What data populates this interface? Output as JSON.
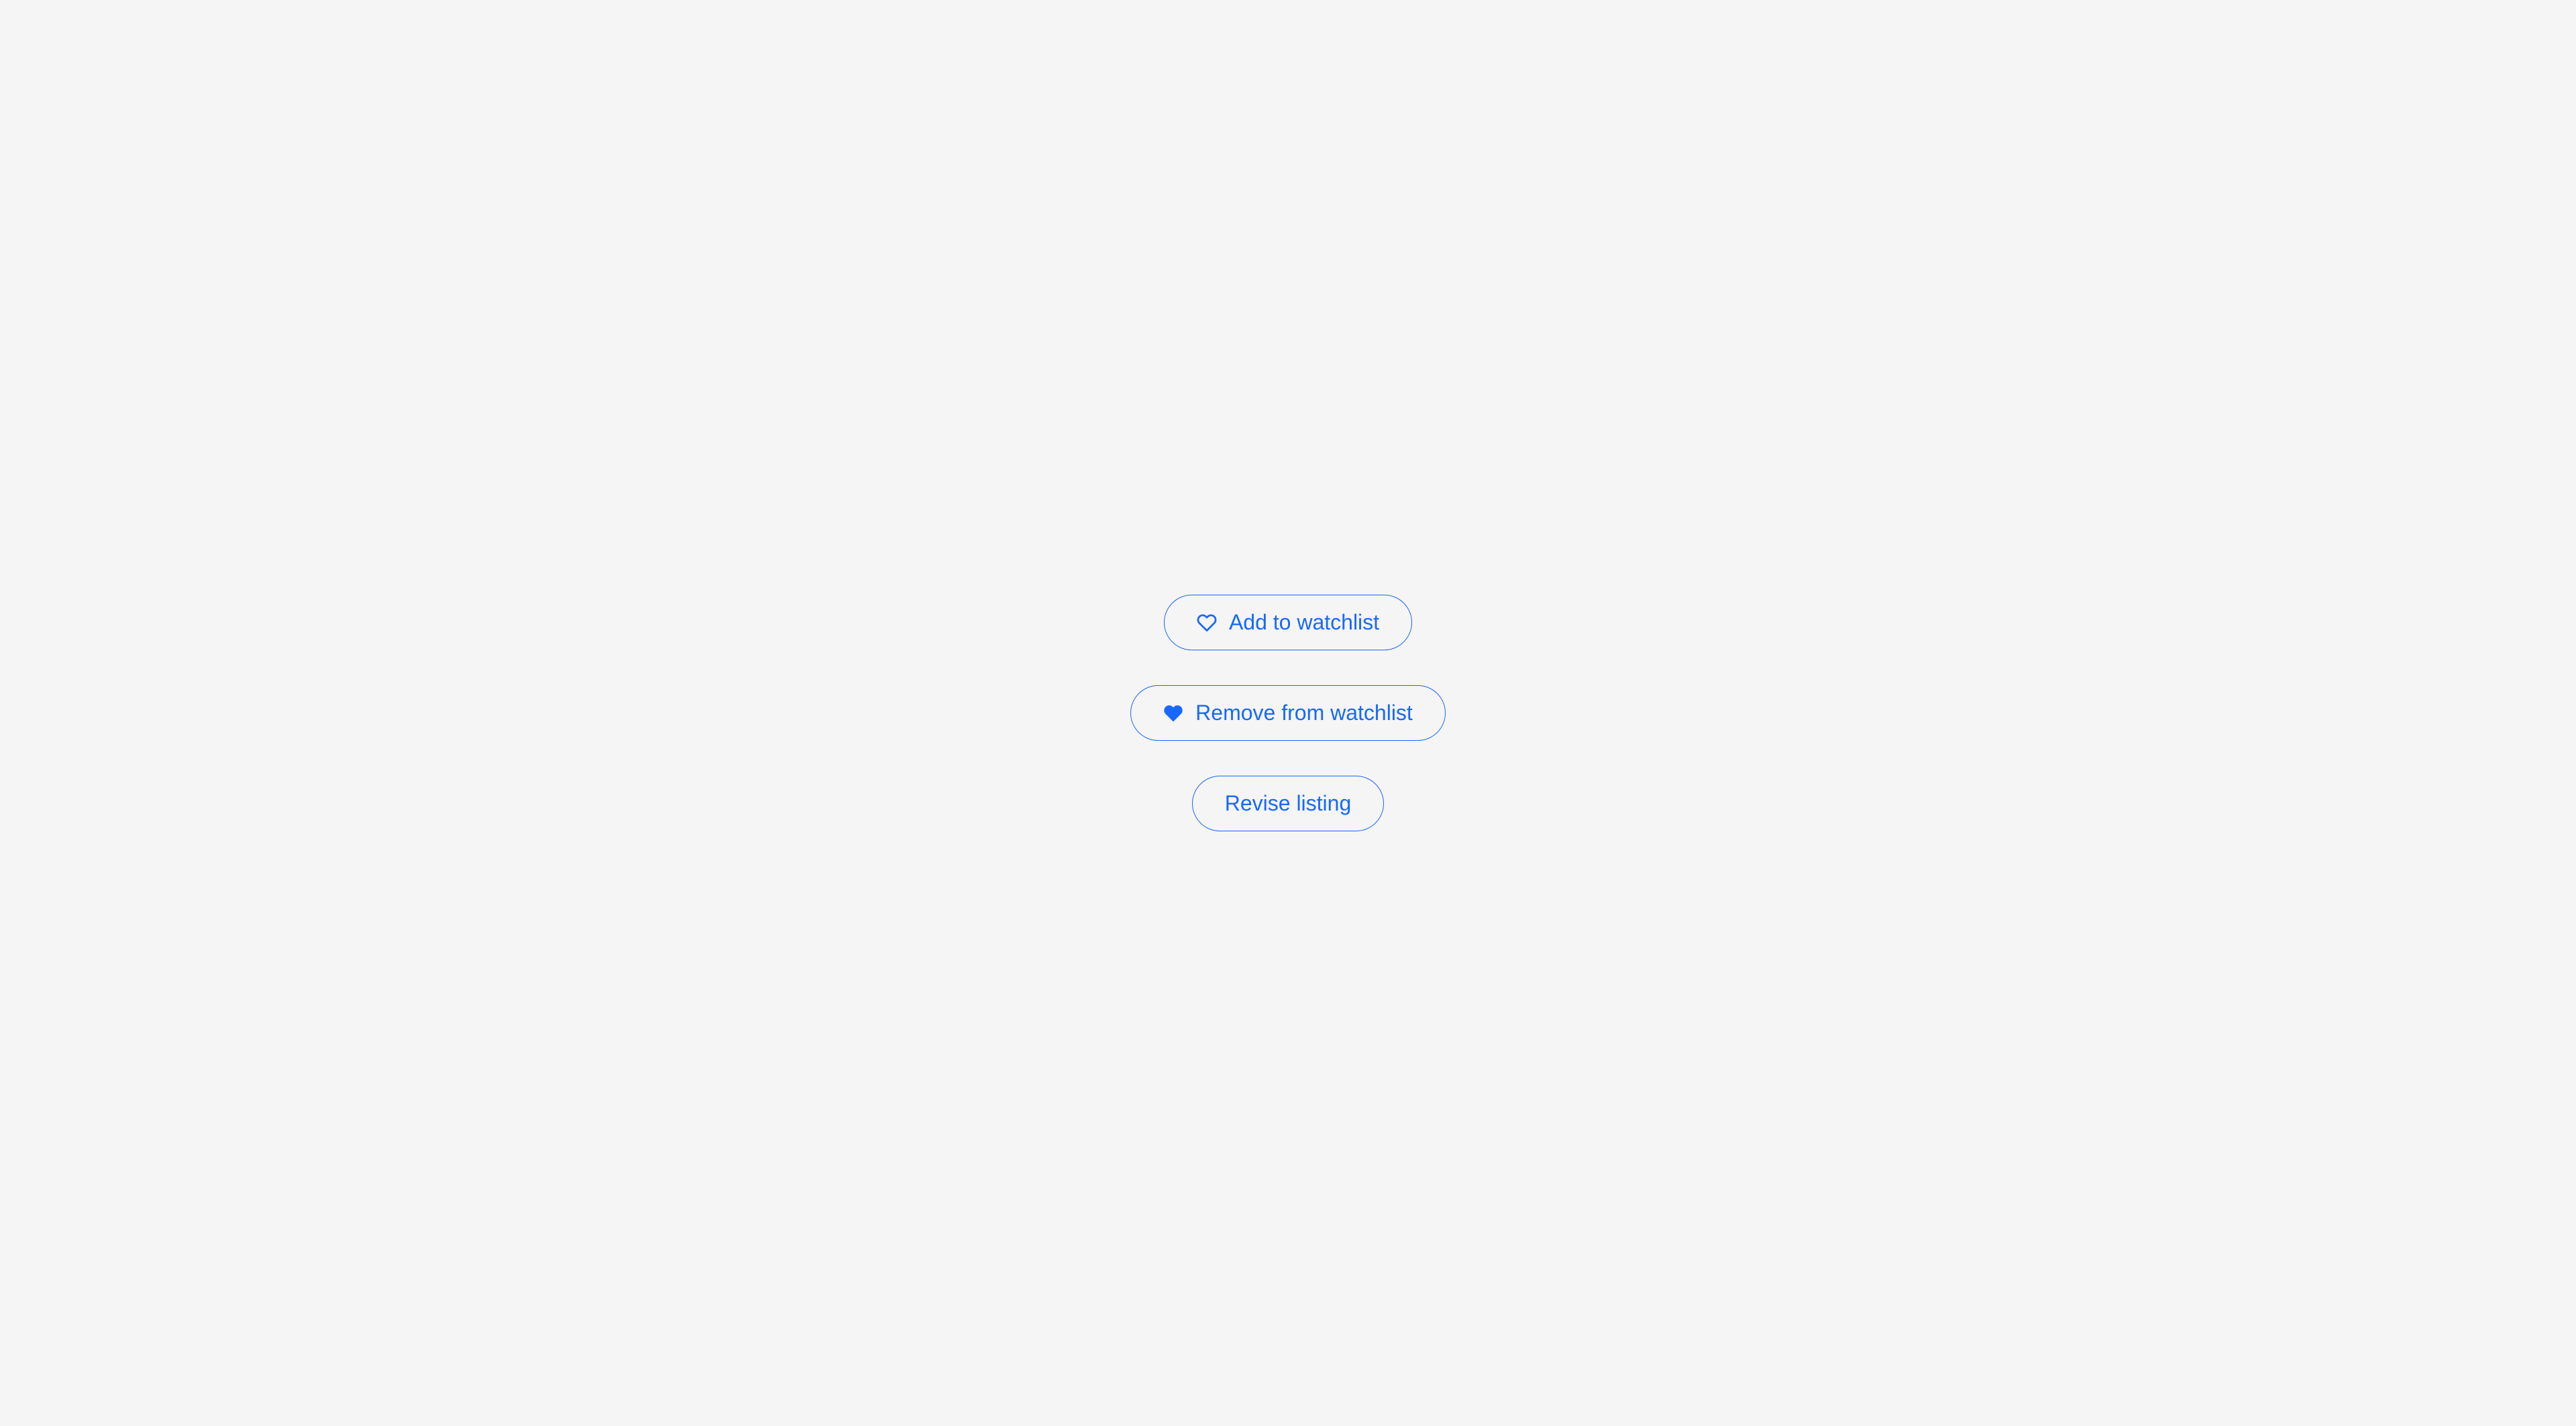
{
  "buttons": {
    "add": {
      "label": "Add to watchlist"
    },
    "remove": {
      "label": "Remove from watchlist"
    },
    "revise": {
      "label": "Revise listing"
    }
  },
  "colors": {
    "accent": "#1868fb",
    "background": "#f5f5f5"
  }
}
